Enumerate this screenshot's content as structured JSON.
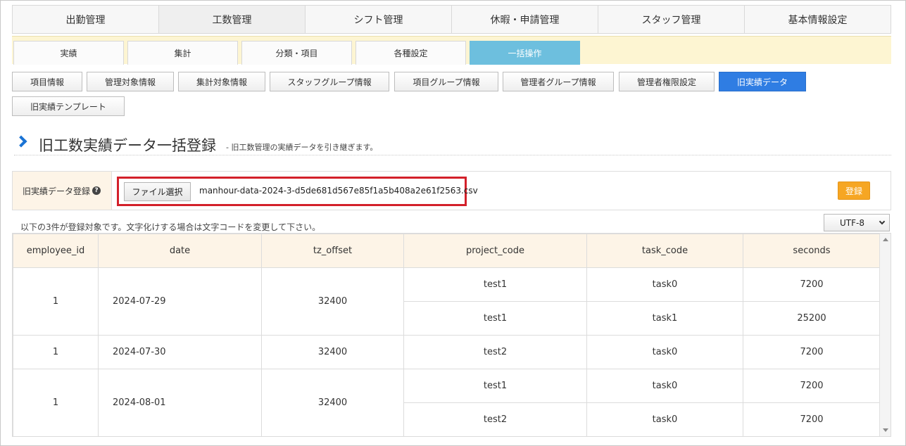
{
  "main_tabs": [
    "出勤管理",
    "工数管理",
    "シフト管理",
    "休暇・申請管理",
    "スタッフ管理",
    "基本情報設定"
  ],
  "sub_tabs": [
    "実績",
    "集計",
    "分類・項目",
    "各種設定",
    "一括操作"
  ],
  "buttons": [
    "項目情報",
    "管理対象情報",
    "集計対象情報",
    "スタッフグループ情報",
    "項目グループ情報",
    "管理者グループ情報",
    "管理者権限設定",
    "旧実績データ",
    "旧実績テンプレート"
  ],
  "heading": {
    "title": "旧工数実績データ一括登録",
    "subtitle": "- 旧工数管理の実績データを引き継ぎます。"
  },
  "form": {
    "label": "旧実績データ登録",
    "help_icon": "?",
    "file_button": "ファイル選択",
    "file_name": "manhour-data-2024-3-d5de681d567e85f1a5b408a2e61f2563.csv",
    "register_button": "登録"
  },
  "note": "以下の3件が登録対象です。文字化けする場合は文字コードを変更して下さい。",
  "encoding": "UTF-8",
  "table": {
    "headers": [
      "employee_id",
      "date",
      "tz_offset",
      "project_code",
      "task_code",
      "seconds"
    ],
    "groups": [
      {
        "employee_id": "1",
        "date": "2024-07-29",
        "tz_offset": "32400",
        "rows": [
          {
            "project_code": "test1",
            "task_code": "task0",
            "seconds": "7200"
          },
          {
            "project_code": "test1",
            "task_code": "task1",
            "seconds": "25200"
          }
        ]
      },
      {
        "employee_id": "1",
        "date": "2024-07-30",
        "tz_offset": "32400",
        "rows": [
          {
            "project_code": "test2",
            "task_code": "task0",
            "seconds": "7200"
          }
        ]
      },
      {
        "employee_id": "1",
        "date": "2024-08-01",
        "tz_offset": "32400",
        "rows": [
          {
            "project_code": "test1",
            "task_code": "task0",
            "seconds": "7200"
          },
          {
            "project_code": "test2",
            "task_code": "task0",
            "seconds": "7200"
          }
        ]
      }
    ]
  },
  "colors": {
    "active_button": "#2f7de3",
    "active_subtab": "#6dbfde",
    "register_button": "#f6a623",
    "highlight_box": "#d3202a"
  }
}
